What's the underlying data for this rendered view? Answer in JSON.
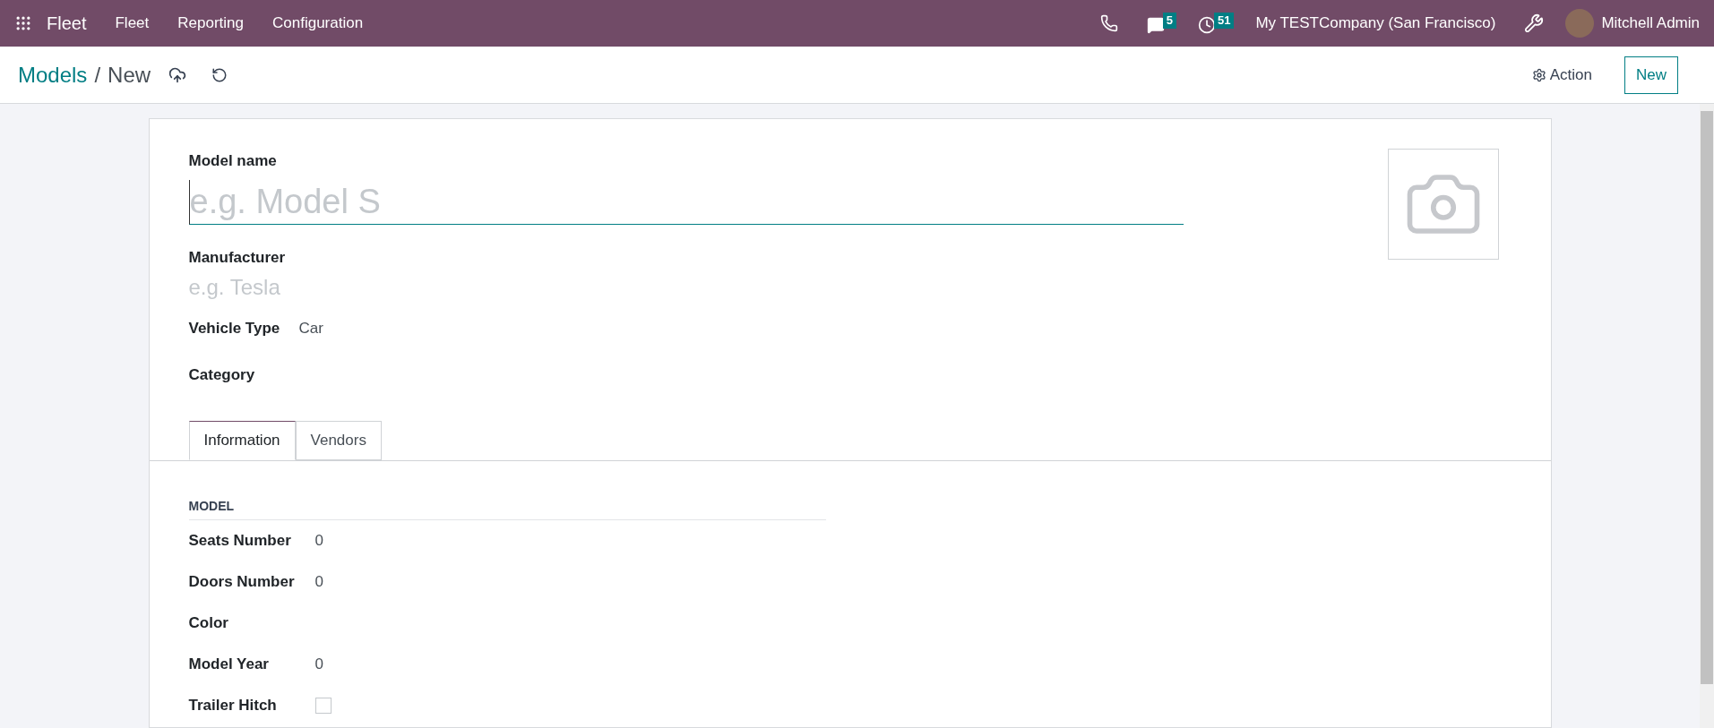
{
  "navbar": {
    "app_name": "Fleet",
    "menu": [
      "Fleet",
      "Reporting",
      "Configuration"
    ],
    "messages_count": "5",
    "activities_count": "51",
    "company": "My TESTCompany (San Francisco)",
    "user": "Mitchell Admin"
  },
  "control_panel": {
    "breadcrumb": "Models",
    "separator": "/",
    "current": "New",
    "action_label": "Action",
    "new_label": "New"
  },
  "form": {
    "model_name": {
      "label": "Model name",
      "placeholder": "e.g. Model S"
    },
    "manufacturer": {
      "label": "Manufacturer",
      "placeholder": "e.g. Tesla"
    },
    "fields": [
      {
        "label": "Vehicle Type",
        "value": "Car"
      },
      {
        "label": "Category"
      }
    ],
    "tabs": [
      {
        "label": "Information",
        "selected": true
      },
      {
        "label": "Vendors",
        "selected": false
      }
    ],
    "section_title": "MODEL",
    "model_fields": [
      {
        "kind": "value",
        "label": "Seats Number",
        "value": "0"
      },
      {
        "kind": "value",
        "label": "Doors Number",
        "value": "0"
      },
      {
        "kind": "value",
        "label": "Color"
      },
      {
        "kind": "value",
        "label": "Model Year",
        "value": "0"
      },
      {
        "kind": "checkbox",
        "label": "Trailer Hitch",
        "checked": false
      }
    ]
  }
}
